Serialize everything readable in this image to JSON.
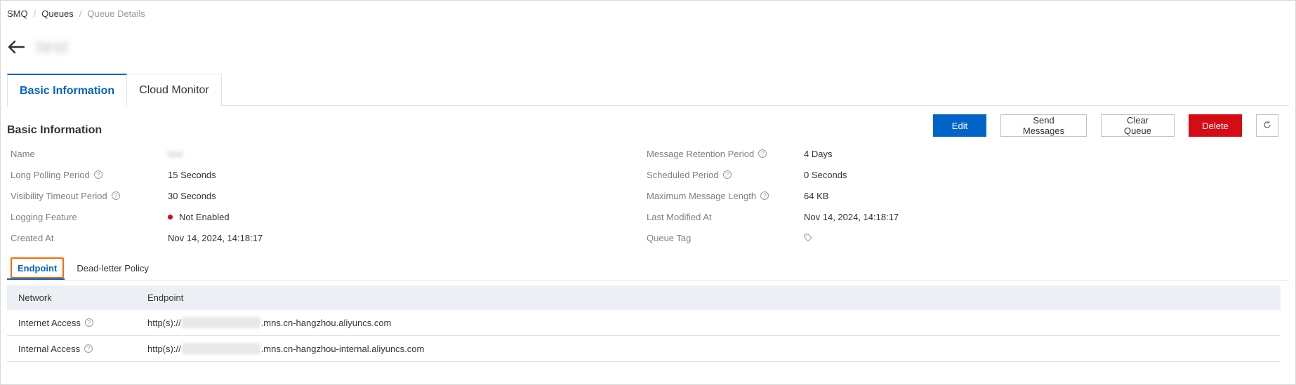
{
  "breadcrumb": [
    "SMQ",
    "Queues",
    "Queue Details"
  ],
  "queue_name": "test",
  "tabs": [
    {
      "label": "Basic Information",
      "active": true
    },
    {
      "label": "Cloud Monitor",
      "active": false
    }
  ],
  "section_title": "Basic Information",
  "actions": {
    "edit": "Edit",
    "send": "Send Messages",
    "clear": "Clear Queue",
    "delete": "Delete",
    "refresh_icon": "refresh-icon"
  },
  "info": {
    "name_label": "Name",
    "name_value": "test",
    "long_polling_label": "Long Polling Period",
    "long_polling_value": "15 Seconds",
    "visibility_label": "Visibility Timeout Period",
    "visibility_value": "30 Seconds",
    "logging_label": "Logging Feature",
    "logging_value": "Not Enabled",
    "created_label": "Created At",
    "created_value": "Nov 14, 2024, 14:18:17",
    "retention_label": "Message Retention Period",
    "retention_value": "4 Days",
    "scheduled_label": "Scheduled Period",
    "scheduled_value": "0 Seconds",
    "max_length_label": "Maximum Message Length",
    "max_length_value": "64 KB",
    "modified_label": "Last Modified At",
    "modified_value": "Nov 14, 2024, 14:18:17",
    "tag_label": "Queue Tag",
    "tag_icon": "tag-icon"
  },
  "subtabs": [
    "Endpoint",
    "Dead-letter Policy"
  ],
  "endpoint_table": {
    "headers": [
      "Network",
      "Endpoint"
    ],
    "rows": [
      {
        "network": "Internet Access",
        "prefix": "http(s)://",
        "suffix": ".mns.cn-hangzhou.aliyuncs.com"
      },
      {
        "network": "Internal Access",
        "prefix": "http(s)://",
        "suffix": ".mns.cn-hangzhou-internal.aliyuncs.com"
      }
    ]
  },
  "colors": {
    "primary": "#0064c8",
    "danger": "#d50b16",
    "highlight": "#ff6a00"
  }
}
